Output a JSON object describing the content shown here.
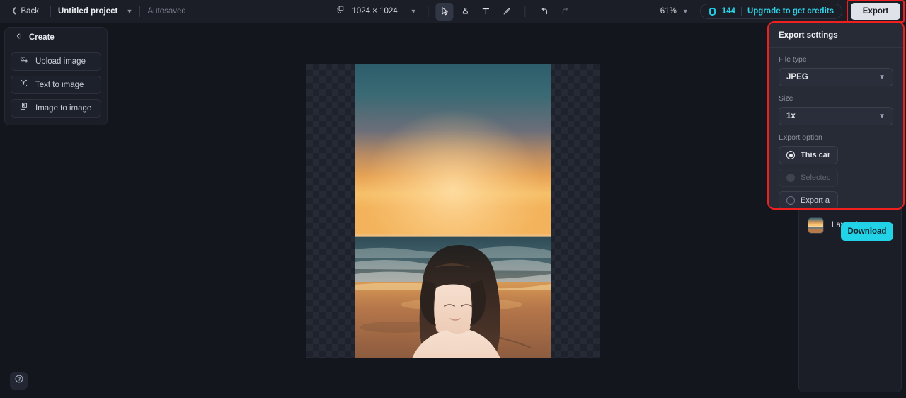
{
  "topbar": {
    "back_label": "Back",
    "project_name": "Untitled project",
    "autosaved_label": "Autosaved",
    "canvas_dimensions": "1024 × 1024",
    "zoom_level": "61%",
    "credits_count": "144",
    "upgrade_label": "Upgrade to get credits",
    "export_label": "Export",
    "tools": [
      {
        "name": "select-tool",
        "active": true
      },
      {
        "name": "eraser-tool",
        "active": false
      },
      {
        "name": "text-tool",
        "active": false
      },
      {
        "name": "brush-tool",
        "active": false
      },
      {
        "name": "undo-tool",
        "active": false
      },
      {
        "name": "redo-tool",
        "active": false
      }
    ]
  },
  "left_panel": {
    "title": "Create",
    "items": [
      {
        "label": "Upload image",
        "icon": "upload-image-icon"
      },
      {
        "label": "Text to image",
        "icon": "text-to-image-icon"
      },
      {
        "label": "Image to image",
        "icon": "image-to-image-icon"
      }
    ]
  },
  "layers_panel": {
    "layers": [
      {
        "name": "Layer 1"
      }
    ]
  },
  "export_settings": {
    "title": "Export settings",
    "file_type_label": "File type",
    "file_type_value": "JPEG",
    "size_label": "Size",
    "size_value": "1x",
    "export_option_label": "Export option",
    "options": [
      {
        "label": "This canvas",
        "selected": true,
        "disabled": false
      },
      {
        "label": "Selected l...",
        "selected": false,
        "disabled": true
      },
      {
        "label": "Export all ...",
        "selected": false,
        "disabled": false
      }
    ],
    "download_label": "Download"
  },
  "colors": {
    "accent": "#22d3e8",
    "highlight": "#ef2020",
    "panel_bg": "#1b1e27",
    "popover_bg": "#272b36"
  }
}
